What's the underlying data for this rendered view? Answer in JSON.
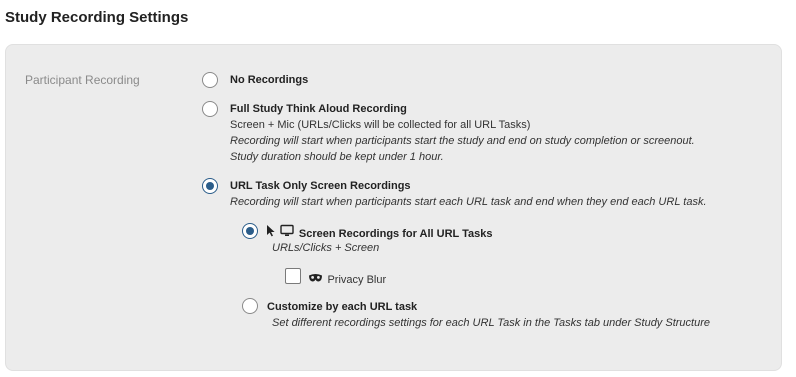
{
  "page": {
    "title": "Study Recording Settings"
  },
  "section": {
    "label": "Participant Recording",
    "options": {
      "no_recordings": {
        "title": "No Recordings",
        "selected": false
      },
      "full_study": {
        "title": "Full Study Think Aloud Recording",
        "desc": "Screen + Mic (URLs/Clicks will be collected for all URL Tasks)",
        "note1": "Recording will start when participants start the study and end on study completion or screenout.",
        "note2": "Study duration should be kept under 1 hour.",
        "selected": false
      },
      "url_task_only": {
        "title": "URL Task Only Screen Recordings",
        "note": "Recording will start when participants start each URL task and end when they end each URL task.",
        "selected": true
      },
      "all_url_tasks": {
        "title": "Screen Recordings for All URL Tasks",
        "desc": "URLs/Clicks + Screen",
        "selected": true
      },
      "privacy_blur": {
        "label": "Privacy Blur",
        "checked": false
      },
      "customize": {
        "title": "Customize by each URL task",
        "desc": "Set different recordings settings for each URL Task in the Tasks tab under Study Structure",
        "selected": false
      }
    }
  },
  "colors": {
    "accent": "#2b5d8a",
    "panel_bg": "#ececec"
  },
  "icons": [
    "cursor-icon",
    "monitor-icon",
    "mask-icon"
  ]
}
